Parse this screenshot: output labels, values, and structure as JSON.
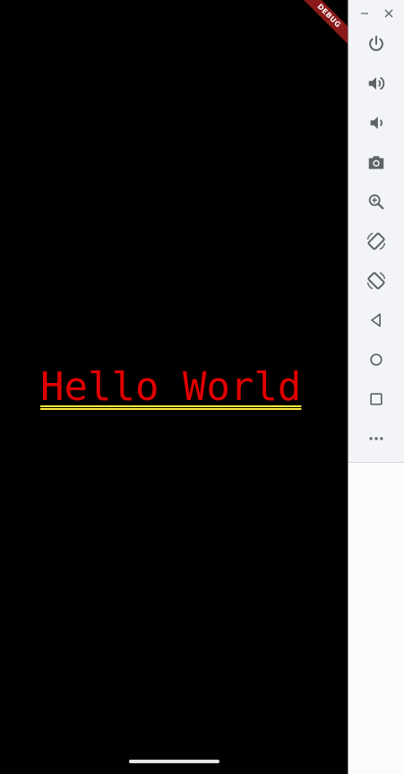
{
  "app": {
    "debug_banner": "DEBUG",
    "hello_text": "Hello World"
  },
  "colors": {
    "screen_background": "#000000",
    "text": "#e00000",
    "underline": "#ffeb3b",
    "debug_ribbon": "#8b1a1a",
    "panel_background": "#f3f4f8",
    "icon": "#5f6368"
  },
  "emulator_panel": {
    "window_controls": [
      "minimize-icon",
      "close-icon"
    ],
    "tools": [
      "power-icon",
      "volume-up-icon",
      "volume-down-icon",
      "camera-icon",
      "zoom-in-icon",
      "rotate-left-icon",
      "rotate-right-icon",
      "back-icon",
      "home-icon",
      "overview-icon",
      "more-icon"
    ]
  }
}
